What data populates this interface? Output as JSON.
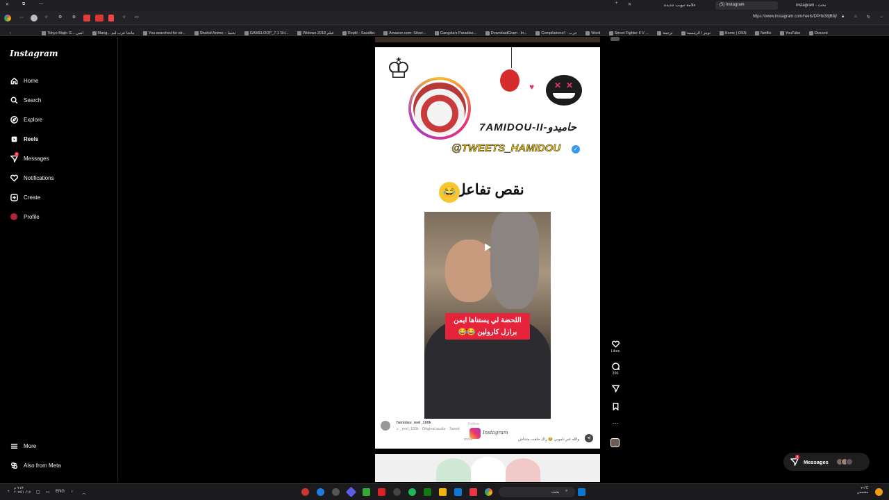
{
  "browser": {
    "tabs": [
      {
        "label": "علامة تبويب جديدة",
        "active": false
      },
      {
        "label": "(5) Instagram",
        "active": true
      },
      {
        "label": "instagram - بحث",
        "active": false
      }
    ],
    "url": "https://www.instagram.com/reels/DPrbi38jB8j/",
    "bookmarks": [
      "Tokyo Majin G... انمي",
      "Mang... ماتجا عرب ليم",
      "You searched for str...",
      "Shahid Anime – تحميا",
      "GAMELOOP_7.1 SH...",
      "Widows 2018 فيلم",
      "Replit - Saudibc",
      "Amazon.com: Silver...",
      "Gangsta's Paradise...",
      "DownloadGram - In...",
      "Compilations!! - جرب",
      "Word",
      "Street Fighter II V ...",
      "ترجمة",
      "تويتر / الرئيسية",
      "Home | OSN",
      "Netflix",
      "YouTube",
      "Discord"
    ]
  },
  "sidebar": {
    "logo": "Instagram",
    "items": [
      {
        "label": "Home",
        "icon": "home-icon"
      },
      {
        "label": "Search",
        "icon": "search-icon"
      },
      {
        "label": "Explore",
        "icon": "compass-icon"
      },
      {
        "label": "Reels",
        "icon": "reels-icon",
        "active": true
      },
      {
        "label": "Messages",
        "icon": "messenger-icon",
        "badge": "5"
      },
      {
        "label": "Notifications",
        "icon": "heart-icon"
      },
      {
        "label": "Create",
        "icon": "plus-square-icon"
      },
      {
        "label": "Profile",
        "icon": "profile-avatar-icon"
      }
    ],
    "more": "More",
    "also_from_meta": "Also from Meta"
  },
  "reel": {
    "handle_arabic": "7AMIDOU-II-حاميدو",
    "handle_twitter": "@TWEETS_HAMIDOU",
    "headline": "نقص تفاعل",
    "headline_emoji": "😂",
    "video_caption_line1": "اللحضة لي يستناها ايمن",
    "video_caption_line2": "برازل كارولين 😂😂",
    "username": "7amidou_reel_100k",
    "follow": "Follow",
    "audio": "♫ _reel_100k · Original audio · 7amid",
    "caption": "والله غير ناموني 😂 راك حلقت متنتاش",
    "more": "more",
    "watermark": "Instagram"
  },
  "actions": {
    "likes_label": "Likes",
    "comments_count": "396"
  },
  "messages_pill": {
    "label": "Messages",
    "badge": "5"
  },
  "taskbar": {
    "time": "٣٦°C",
    "weather_desc": "مشمس",
    "lang": "ENG",
    "clock": "٩:٤٣ م",
    "date": "٢٠٢٥/١٠/١٧",
    "search_placeholder": "بحث"
  }
}
